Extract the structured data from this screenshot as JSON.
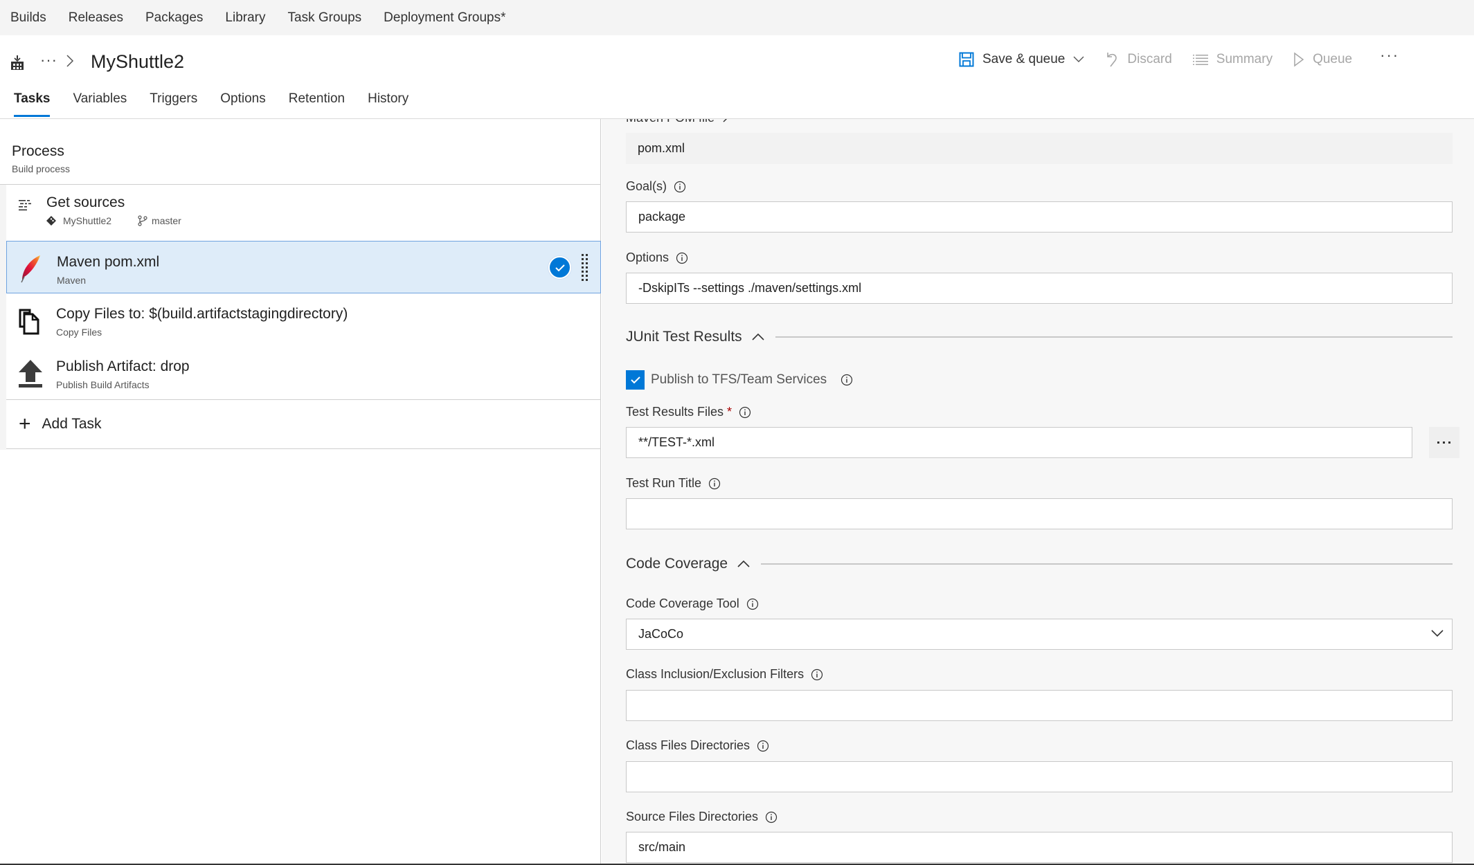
{
  "hub_nav": {
    "items": [
      "Builds",
      "Releases",
      "Packages",
      "Library",
      "Task Groups",
      "Deployment Groups*"
    ]
  },
  "header": {
    "breadcrumb_ellipsis": "···",
    "title": "MyShuttle2",
    "toolbar": {
      "save_queue": "Save & queue",
      "discard": "Discard",
      "summary": "Summary",
      "queue": "Queue",
      "more": "···"
    }
  },
  "tabs": [
    {
      "label": "Tasks",
      "active": true
    },
    {
      "label": "Variables"
    },
    {
      "label": "Triggers"
    },
    {
      "label": "Options"
    },
    {
      "label": "Retention"
    },
    {
      "label": "History"
    }
  ],
  "process": {
    "title": "Process",
    "subtitle": "Build process",
    "get_sources": {
      "label": "Get sources",
      "repo": "MyShuttle2",
      "branch": "master"
    },
    "tasks": [
      {
        "name": "Maven pom.xml",
        "type": "Maven",
        "icon": "maven-feather-icon",
        "selected": true
      },
      {
        "name": "Copy Files to: $(build.artifactstagingdirectory)",
        "type": "Copy Files",
        "icon": "copy-files-icon"
      },
      {
        "name": "Publish Artifact: drop",
        "type": "Publish Build Artifacts",
        "icon": "upload-icon"
      }
    ],
    "add_task": "Add Task"
  },
  "details": {
    "pom_file": {
      "label": "Maven POM file",
      "value": "pom.xml"
    },
    "goals": {
      "label": "Goal(s)",
      "value": "package"
    },
    "options": {
      "label": "Options",
      "value": "-DskipITs --settings ./maven/settings.xml"
    },
    "junit_section": {
      "title": "JUnit Test Results",
      "publish_checkbox": {
        "label": "Publish to TFS/Team Services",
        "checked": true
      },
      "test_results_files": {
        "label": "Test Results Files",
        "required_mark": "*",
        "value": "**/TEST-*.xml"
      },
      "test_run_title": {
        "label": "Test Run Title",
        "value": ""
      }
    },
    "coverage_section": {
      "title": "Code Coverage",
      "tool": {
        "label": "Code Coverage Tool",
        "value": "JaCoCo"
      },
      "class_filters": {
        "label": "Class Inclusion/Exclusion Filters",
        "value": ""
      },
      "class_dirs": {
        "label": "Class Files Directories",
        "value": ""
      },
      "source_dirs": {
        "label": "Source Files Directories",
        "value": "src/main"
      }
    }
  },
  "colors": {
    "accent": "#0078d7",
    "selected_row_bg": "#deecf9",
    "required": "#a80000"
  }
}
